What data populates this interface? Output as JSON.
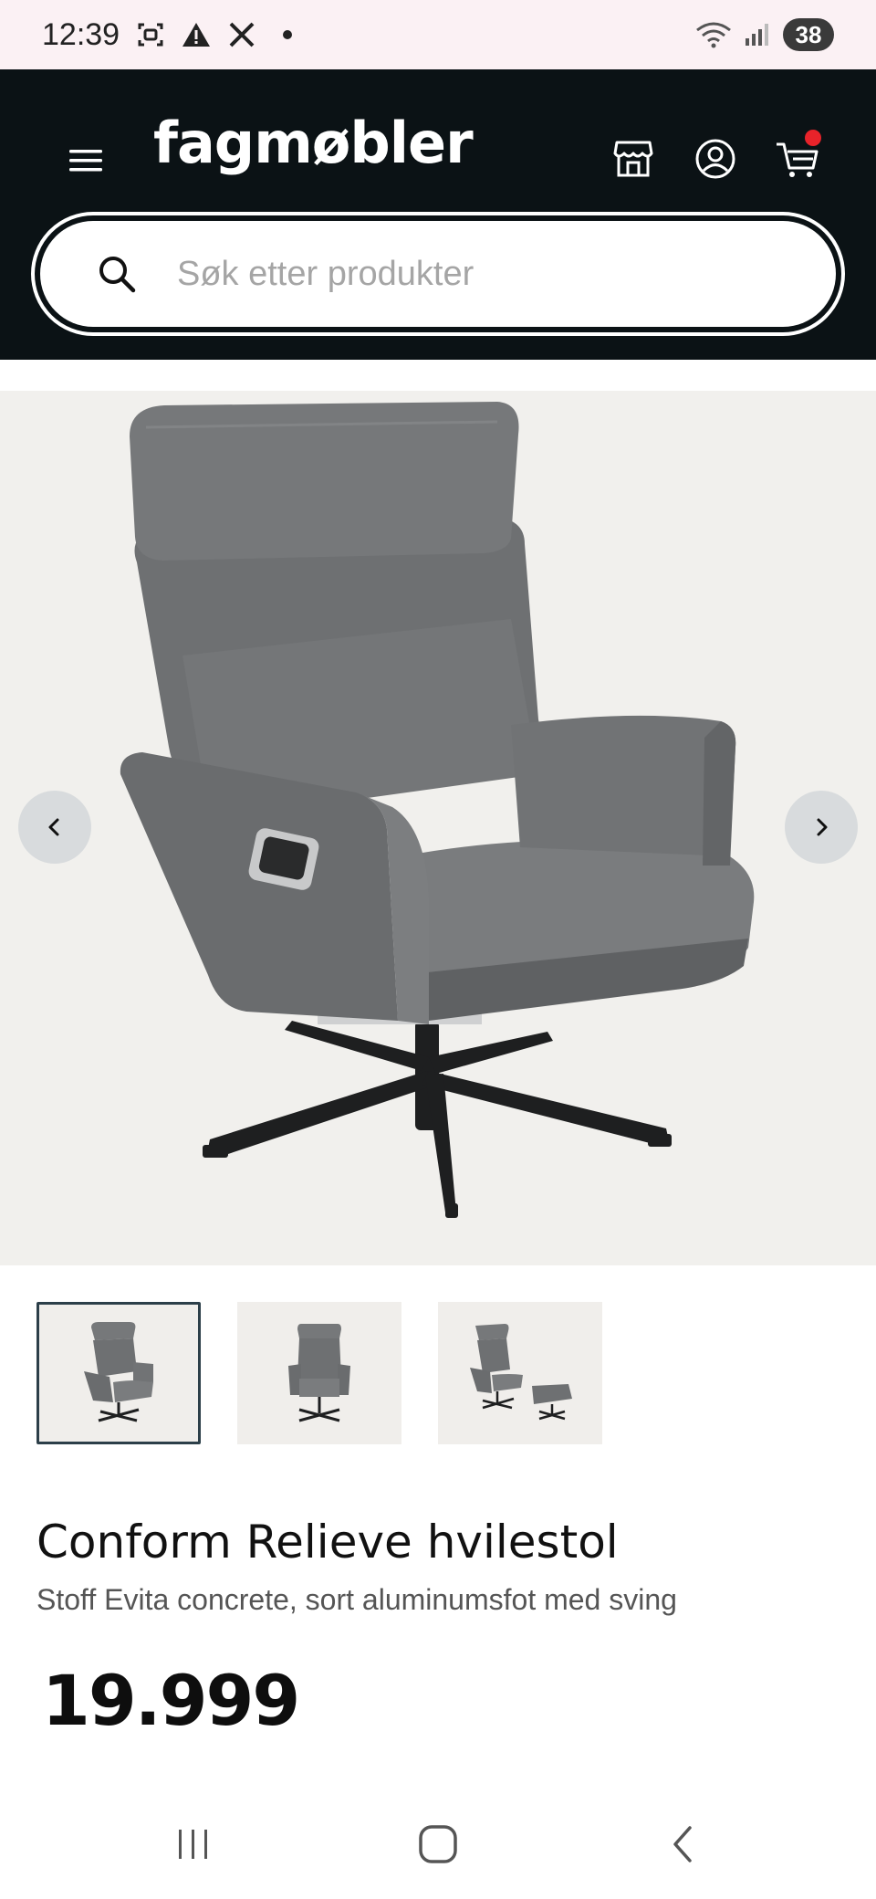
{
  "status_bar": {
    "time": "12:39",
    "battery": "38",
    "icons": [
      "screenshot-icon",
      "warning-icon",
      "x-logo-icon",
      "dot-icon",
      "wifi-icon",
      "signal-icon"
    ]
  },
  "header": {
    "logo": "fagmøbler",
    "icons": [
      "menu-icon",
      "store-icon",
      "account-icon",
      "cart-icon"
    ],
    "cart_badge_color": "#e8232a"
  },
  "search": {
    "placeholder": "Søk etter produkter"
  },
  "gallery": {
    "main_image": "grey-recliner-chair",
    "thumbnails": [
      "chair-angle-view",
      "chair-front-view",
      "chair-with-footstool"
    ],
    "active_index": 0
  },
  "product": {
    "title": "Conform Relieve hvilestol",
    "subtitle": "Stoff Evita concrete, sort aluminumsfot med sving",
    "price": "19.999"
  },
  "system_nav": {
    "icons": [
      "recent-apps-icon",
      "home-icon",
      "back-icon"
    ]
  },
  "colors": {
    "header_bg": "#0b1215",
    "status_bg": "#fbf1f4",
    "hero_bg": "#f1f0ed",
    "chair_fabric": "#6b6d6f"
  }
}
